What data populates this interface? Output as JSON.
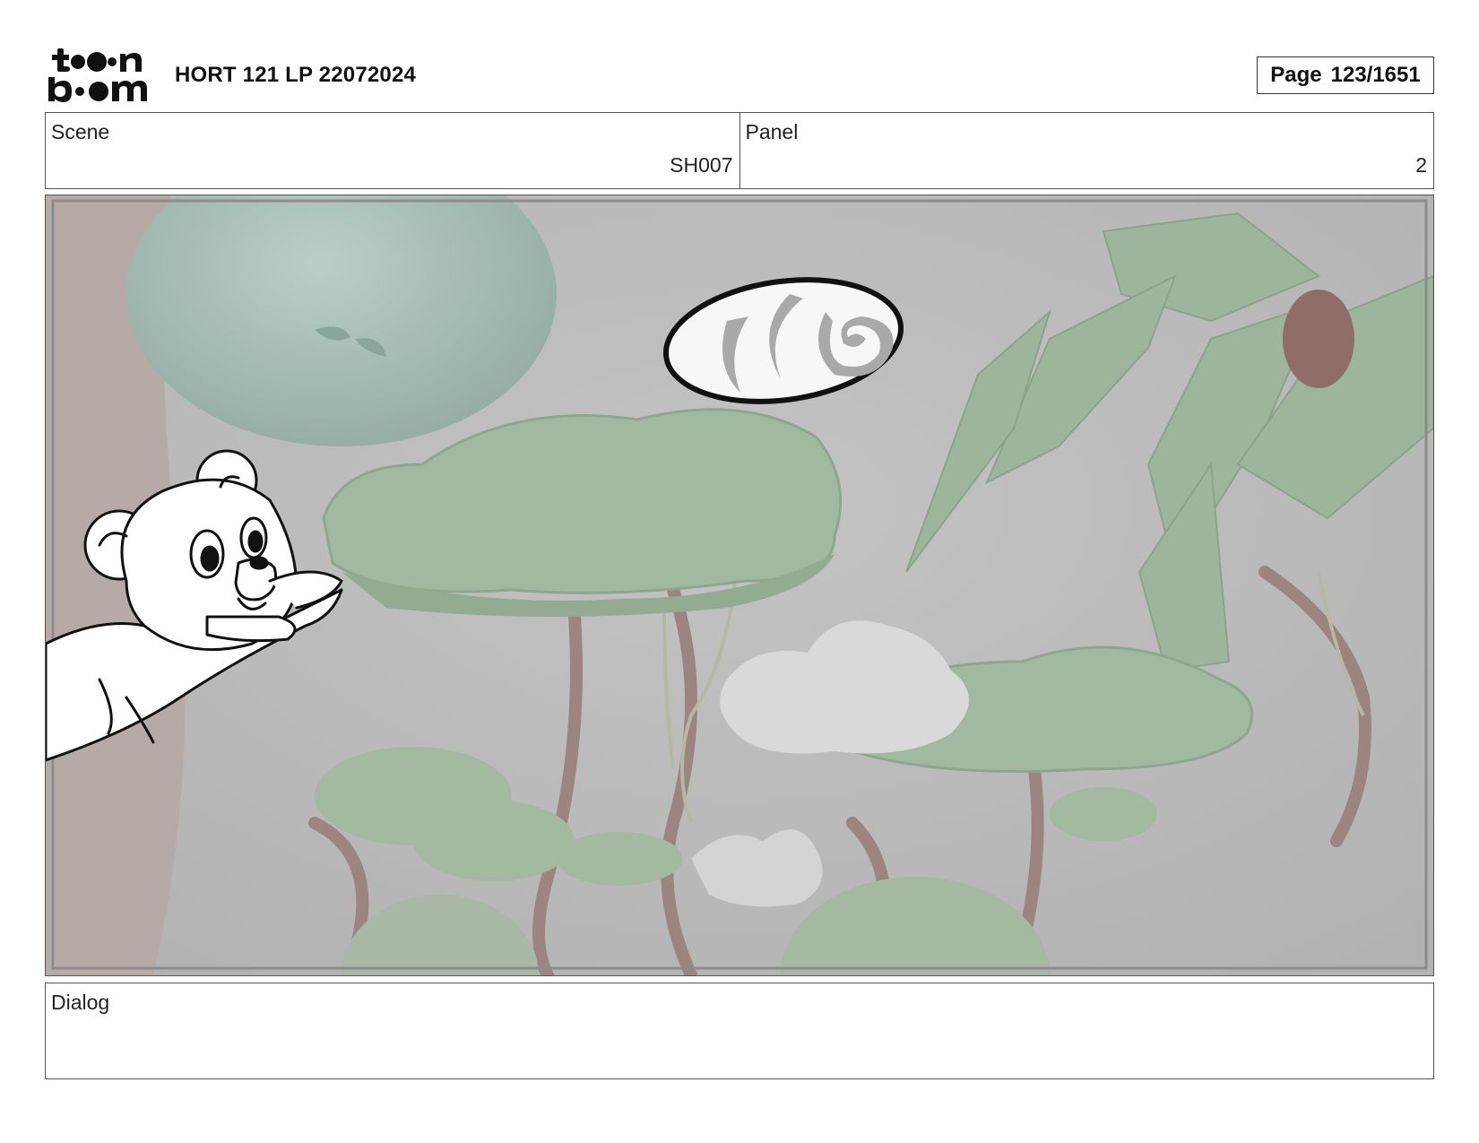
{
  "header": {
    "logo_text": "toon boom",
    "project_title": "HORT 121 LP 22072024",
    "page_label": "Page",
    "page_number": "123/1651"
  },
  "info": {
    "scene_label": "Scene",
    "scene_value": "SH007",
    "panel_label": "Panel",
    "panel_value": "2"
  },
  "panel_image": {
    "icons": [
      "bear-cub-sketch",
      "swirl-portal-ellipse",
      "jungle-background"
    ]
  },
  "dialog": {
    "label": "Dialog",
    "text": ""
  }
}
